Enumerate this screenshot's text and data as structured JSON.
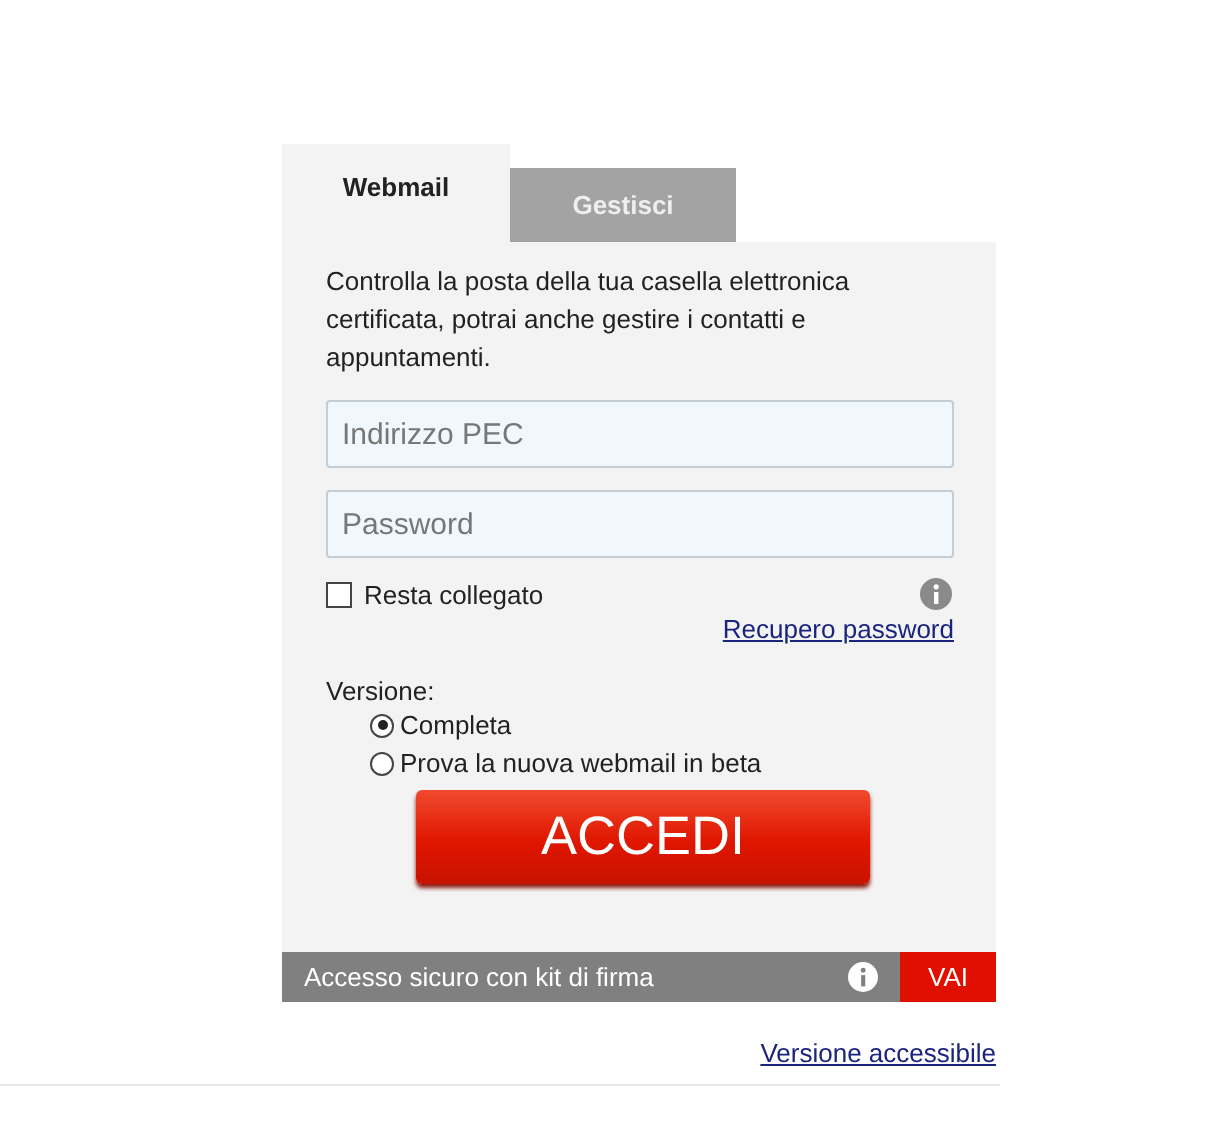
{
  "tabs": [
    {
      "label": "Webmail",
      "selected": true
    },
    {
      "label": "Gestisci",
      "selected": false
    }
  ],
  "description": "Controlla la posta della tua casella elettronica certificata, potrai anche gestire i contatti e appuntamenti.",
  "fields": [
    {
      "placeholder": "Indirizzo PEC"
    },
    {
      "placeholder": "Password"
    }
  ],
  "remember": {
    "label": "Resta collegato",
    "checked": false
  },
  "recover_link": "Recupero password",
  "version": {
    "label": "Versione:",
    "options": [
      {
        "label": "Completa",
        "selected": true
      },
      {
        "label": "Prova la nuova webmail in beta",
        "selected": false
      }
    ]
  },
  "submit": "ACCEDI",
  "secure_bar": {
    "text": "Accesso sicuro con kit di firma",
    "button": "VAI"
  },
  "accessible_link": "Versione accessibile"
}
